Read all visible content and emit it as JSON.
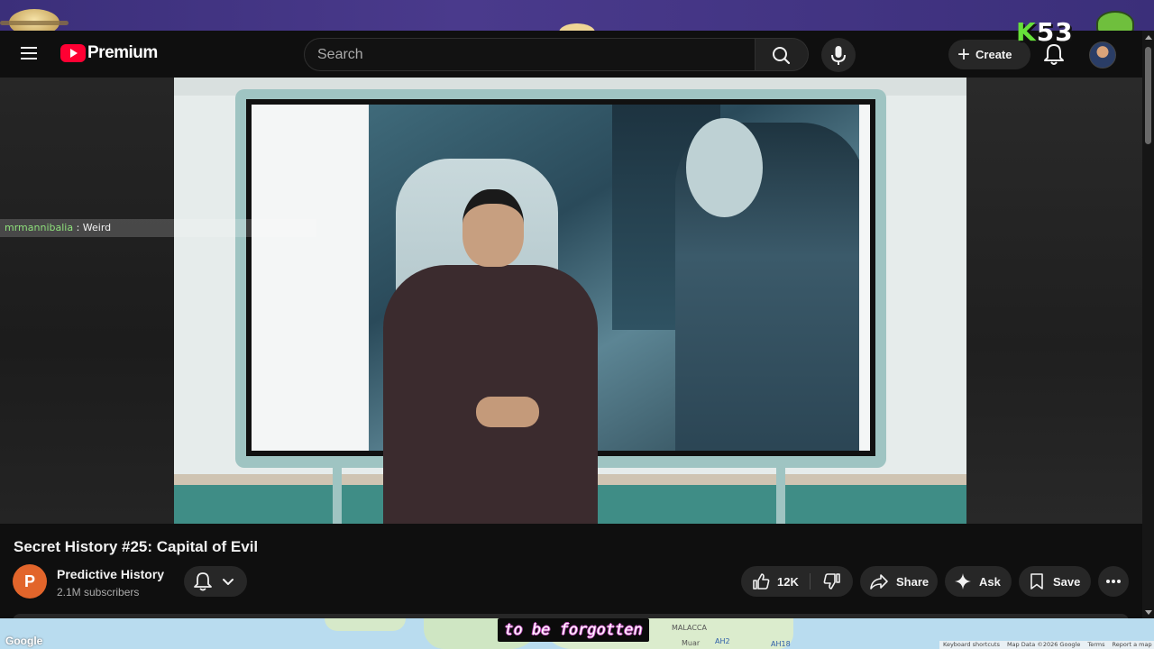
{
  "stream_overlay": {
    "score_k": "K",
    "score_num": "53",
    "chat": {
      "user": "mrmannibalia",
      "separator": " : ",
      "message": "Weird"
    },
    "caption": "to be forgotten"
  },
  "header": {
    "logo_text": "Premium",
    "search": {
      "placeholder": "Search",
      "value": ""
    },
    "create_label": "Create"
  },
  "video": {
    "title": "Secret History #25: Capital of Evil",
    "channel": {
      "initial": "P",
      "name": "Predictive History",
      "subscribers": "2.1M subscribers"
    },
    "actions": {
      "likes": "12K",
      "share": "Share",
      "ask": "Ask",
      "save": "Save"
    }
  },
  "map": {
    "google_mark": "Google",
    "place_labels": [
      "MALACCA",
      "Muar",
      "AH2",
      "AH18"
    ],
    "footer_links": [
      "Keyboard shortcuts",
      "Map Data ©2026 Google",
      "Terms",
      "Report a map error"
    ]
  },
  "colors": {
    "brand": "#ff0033",
    "channel_avatar": "#e2652b",
    "banner": "#3b2f7a"
  },
  "icons": [
    "menu-icon",
    "youtube-logo-icon",
    "search-icon",
    "mic-icon",
    "plus-icon",
    "bell-icon",
    "chevron-down-icon",
    "thumbs-up-icon",
    "thumbs-down-icon",
    "share-icon",
    "sparkle-icon",
    "bookmark-icon",
    "more-icon"
  ]
}
